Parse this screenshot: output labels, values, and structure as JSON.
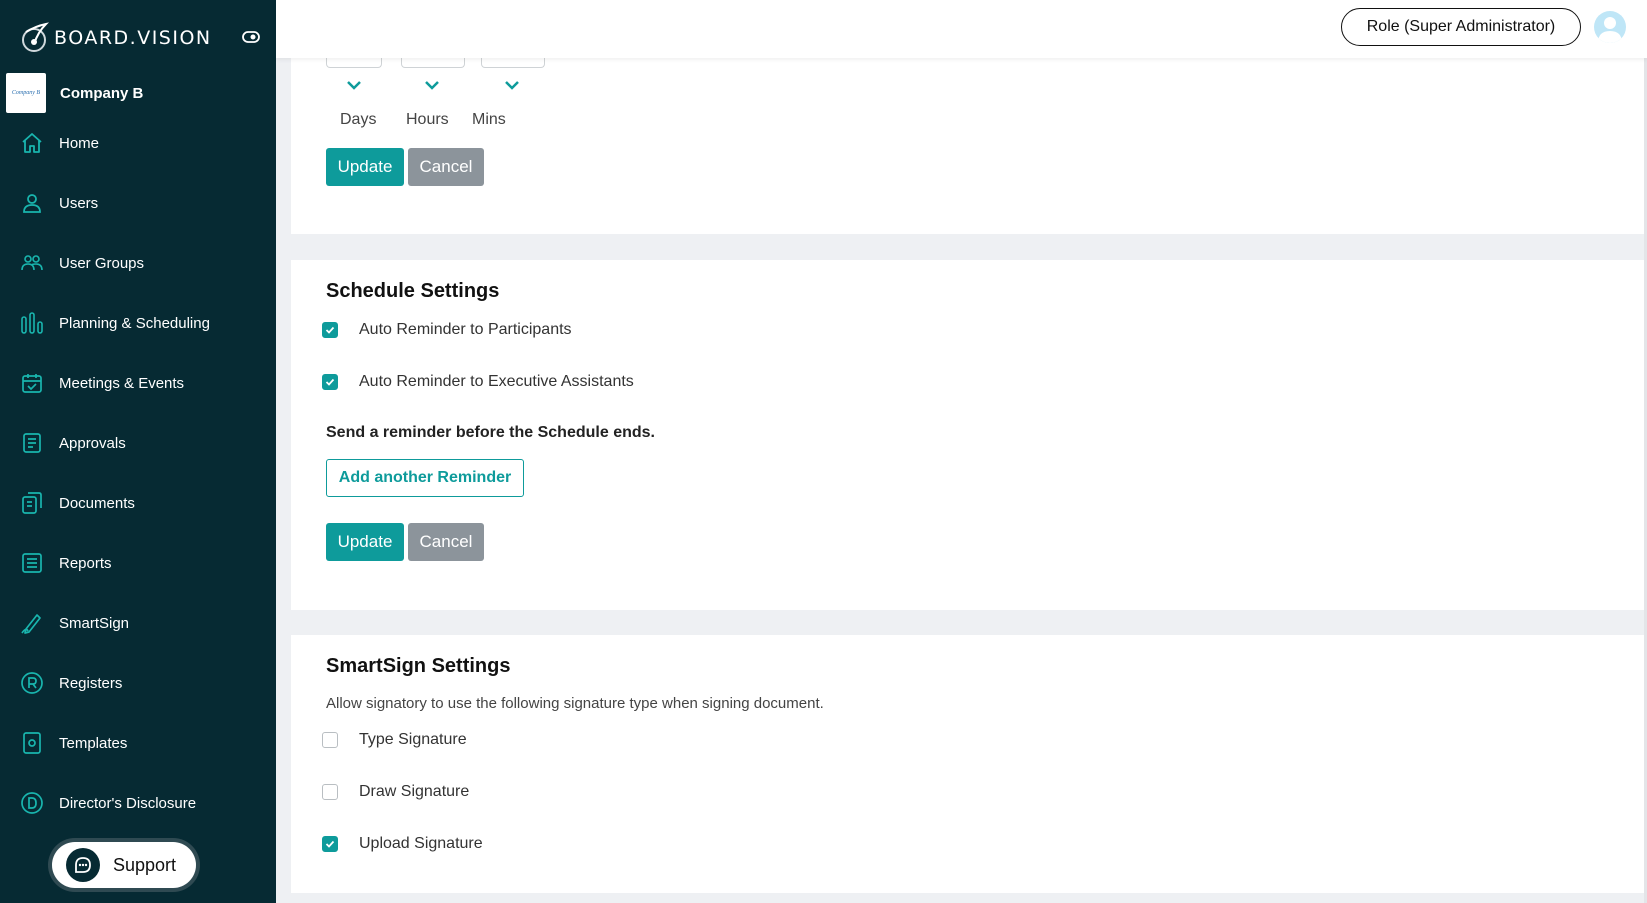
{
  "brand": {
    "name": "BOARD.VISION"
  },
  "company": {
    "name": "Company B",
    "logo_text": "Company B"
  },
  "nav": [
    {
      "label": "Home",
      "icon": "home-icon"
    },
    {
      "label": "Users",
      "icon": "user-icon"
    },
    {
      "label": "User Groups",
      "icon": "user-group-icon"
    },
    {
      "label": "Planning & Scheduling",
      "icon": "bar-chart-icon"
    },
    {
      "label": "Meetings & Events",
      "icon": "calendar-icon"
    },
    {
      "label": "Approvals",
      "icon": "approval-document-icon"
    },
    {
      "label": "Documents",
      "icon": "documents-icon"
    },
    {
      "label": "Reports",
      "icon": "reports-icon"
    },
    {
      "label": "SmartSign",
      "icon": "pen-icon"
    },
    {
      "label": "Registers",
      "icon": "registered-icon"
    },
    {
      "label": "Templates",
      "icon": "template-icon"
    },
    {
      "label": "Director's Disclosure",
      "icon": "disclosure-icon"
    }
  ],
  "support": {
    "label": "Support"
  },
  "topbar": {
    "role_label": "Role (Super Administrator)"
  },
  "time_settings": {
    "labels": [
      "Days",
      "Hours",
      "Mins"
    ],
    "update_label": "Update",
    "cancel_label": "Cancel"
  },
  "schedule": {
    "title": "Schedule Settings",
    "options": [
      {
        "label": "Auto Reminder to Participants",
        "checked": true
      },
      {
        "label": "Auto Reminder to Executive Assistants",
        "checked": true
      }
    ],
    "reminder_note": "Send a reminder before the Schedule ends.",
    "add_reminder_label": "Add another Reminder",
    "update_label": "Update",
    "cancel_label": "Cancel"
  },
  "smartsign": {
    "title": "SmartSign Settings",
    "description": "Allow signatory to use the following signature type when signing document.",
    "options": [
      {
        "label": "Type Signature",
        "checked": false
      },
      {
        "label": "Draw Signature",
        "checked": false
      },
      {
        "label": "Upload Signature",
        "checked": true
      }
    ]
  },
  "colors": {
    "sidebar_bg": "#062a33",
    "accent": "#0e9b9b",
    "cancel": "#8c949b"
  }
}
